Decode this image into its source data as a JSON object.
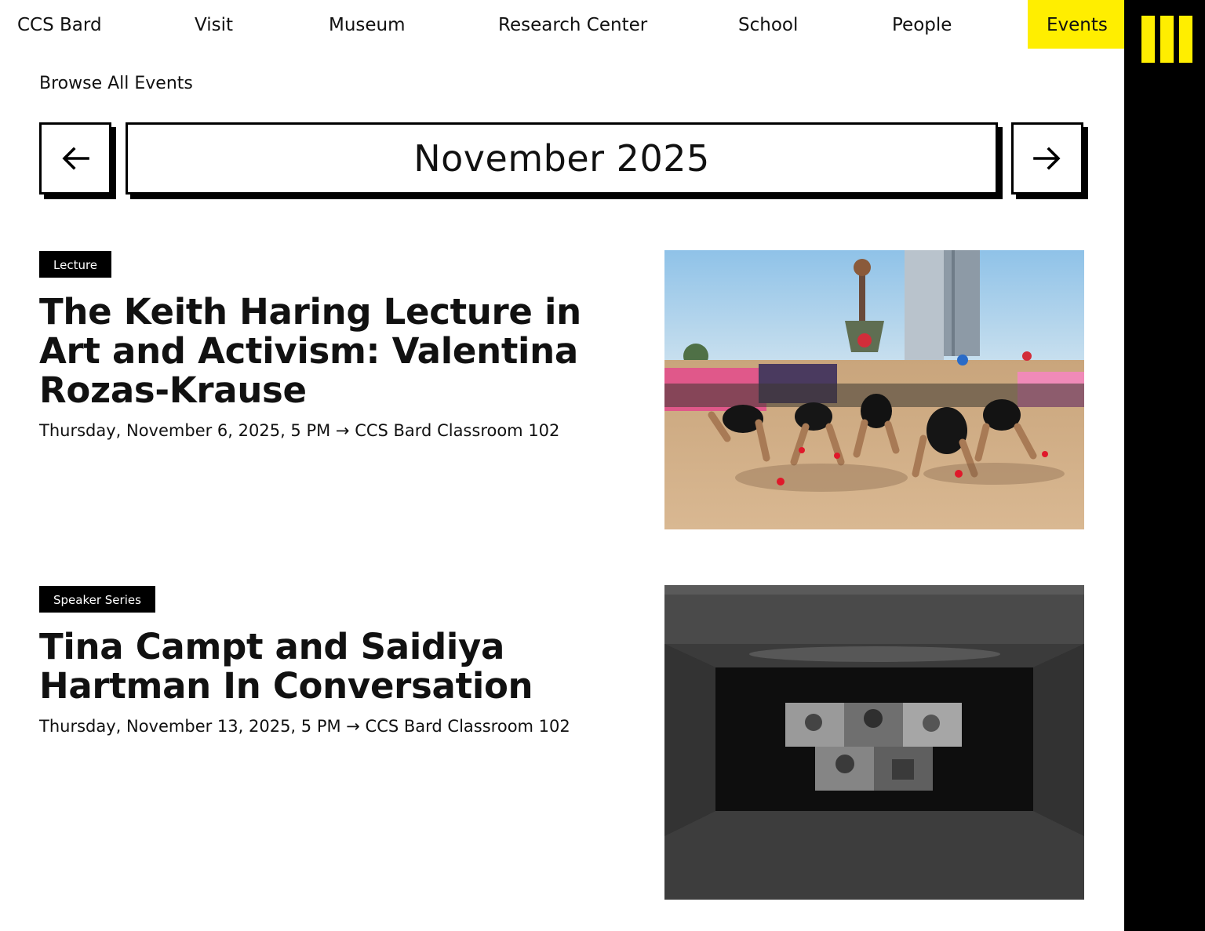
{
  "nav": {
    "items": [
      {
        "label": "CCS Bard"
      },
      {
        "label": "Visit"
      },
      {
        "label": "Museum"
      },
      {
        "label": "Research Center"
      },
      {
        "label": "School"
      },
      {
        "label": "People"
      },
      {
        "label": "Events"
      }
    ],
    "active_item": "Events",
    "menu_icon": "menu-bars-icon"
  },
  "colors": {
    "accent": "#ffee00",
    "sidebar": "#000000",
    "tag_bg": "#000000",
    "text": "#111111"
  },
  "browse": {
    "label": "Browse All Events"
  },
  "calendar": {
    "month": "November 2025",
    "prev_icon": "arrow-left-icon",
    "next_icon": "arrow-right-icon"
  },
  "events": [
    {
      "tag": "Lecture",
      "title": "The Keith Haring Lecture in Art and Activism: Valentina Rozas-Krause",
      "meta": "Thursday, November 6, 2025,  5 PM → CCS Bard Classroom 102"
    },
    {
      "tag": "Speaker Series",
      "title": "Tina Campt and Saidiya Hartman In Conversation",
      "meta": "Thursday, November 13, 2025,  5 PM → CCS Bard Classroom 102"
    }
  ]
}
